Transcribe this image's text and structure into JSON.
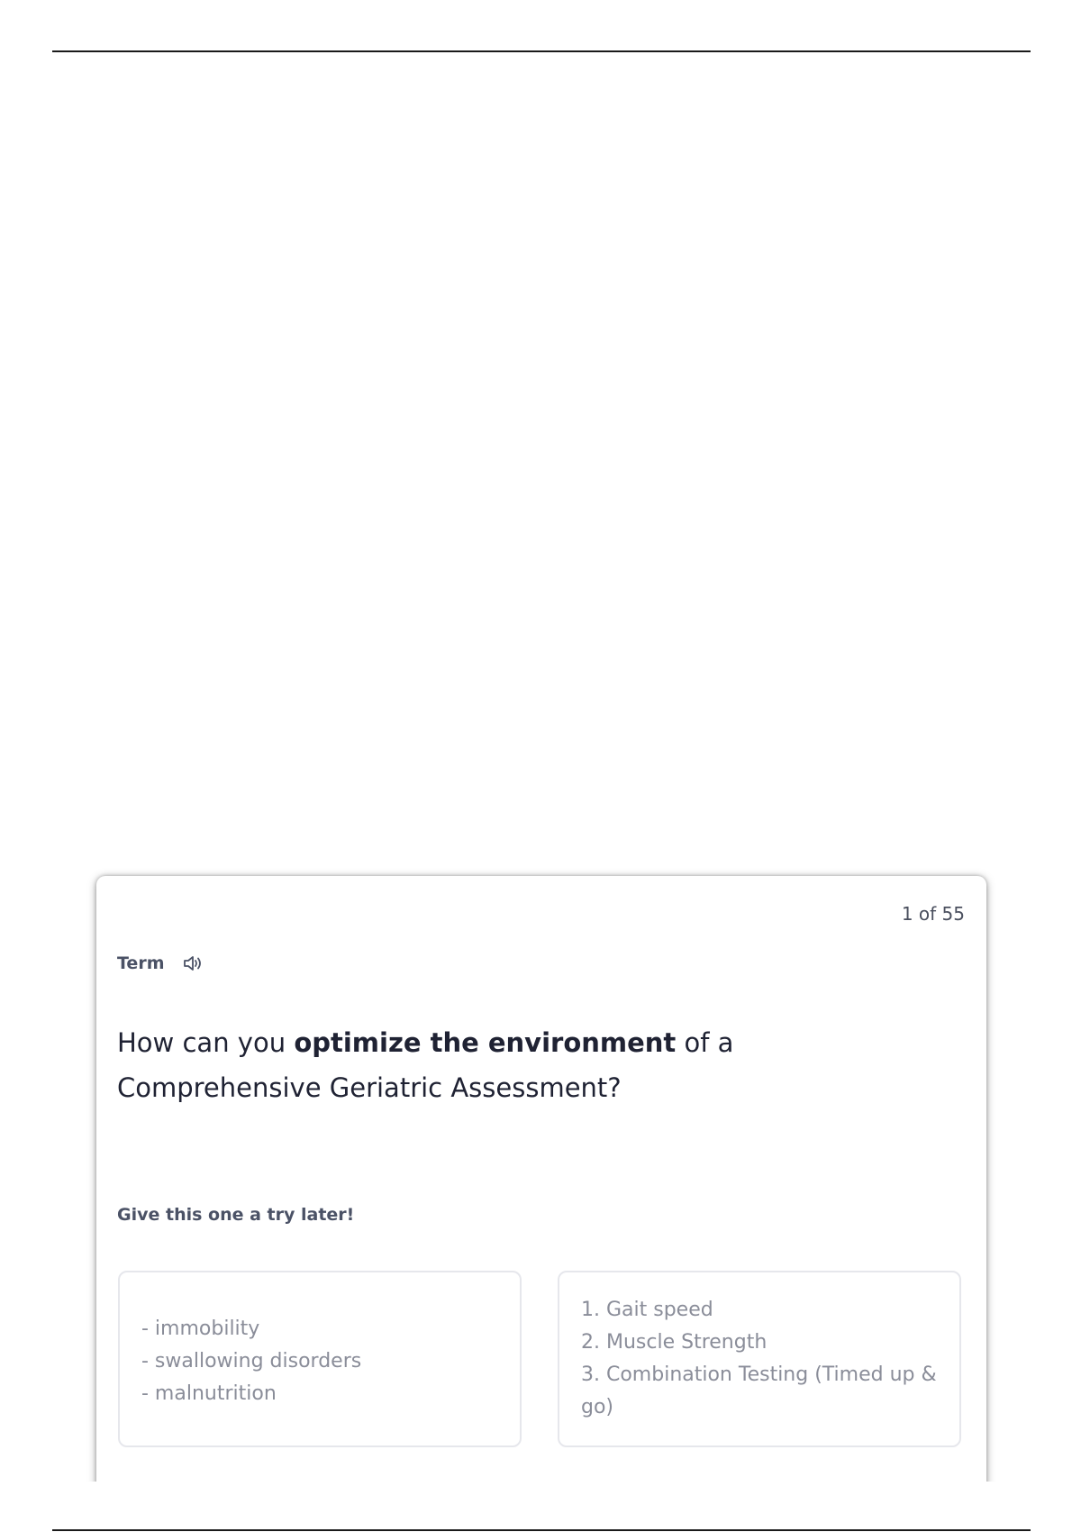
{
  "card": {
    "counter": "1 of 55",
    "term_label": "Term",
    "speaker_icon": "speaker-icon",
    "question": {
      "prefix": "How can you ",
      "emphasis": "optimize the environment",
      "suffix": " of a Comprehensive Geriatric Assessment?"
    },
    "hint": "Give this one a try later!",
    "options": [
      {
        "lines": [
          "- immobility",
          "- swallowing disorders",
          "- malnutrition"
        ]
      },
      {
        "lines": [
          "1. Gait speed",
          "2. Muscle Strength",
          "3. Combination Testing (Timed up &",
          "go)"
        ]
      }
    ]
  }
}
